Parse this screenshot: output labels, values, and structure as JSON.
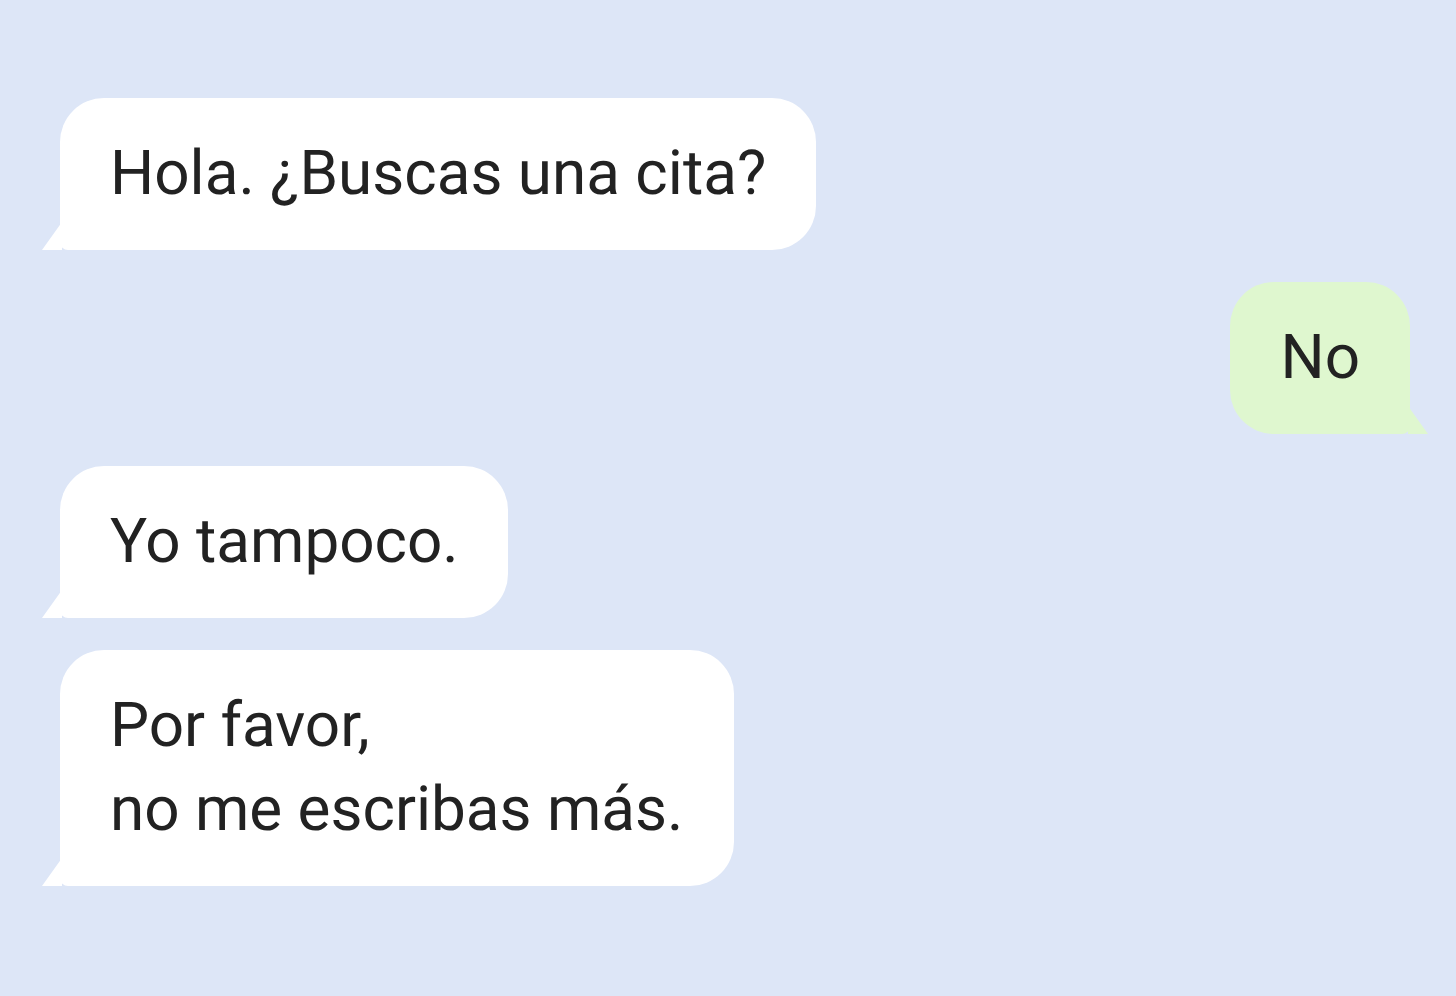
{
  "messages": [
    {
      "kind": "incoming",
      "text": "Hola. ¿Buscas una cita?"
    },
    {
      "kind": "outgoing",
      "text": "No"
    },
    {
      "kind": "incoming",
      "text": "Yo tampoco."
    },
    {
      "kind": "incoming",
      "text": "Por favor,\nno me escribas más."
    }
  ]
}
